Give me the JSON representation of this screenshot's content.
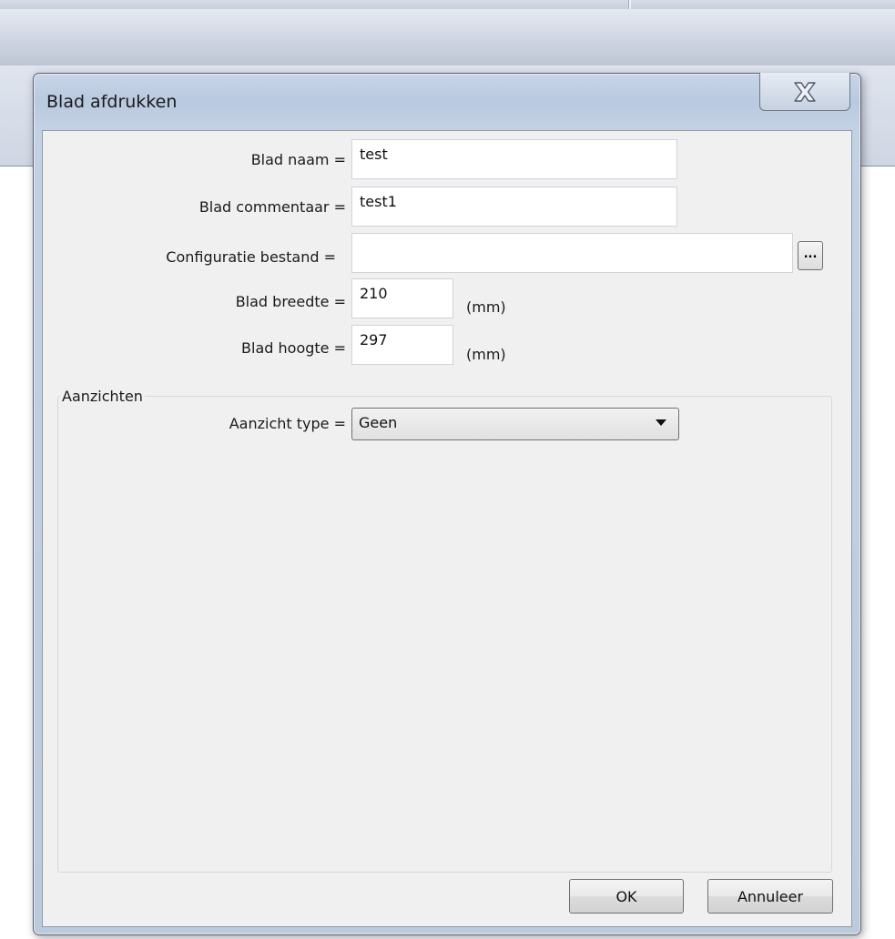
{
  "dialog": {
    "title": "Blad afdrukken",
    "close_icon": "close-icon"
  },
  "form": {
    "sheet_name": {
      "label": "Blad naam =",
      "value": "test"
    },
    "sheet_comment": {
      "label": "Blad commentaar =",
      "value": "test1"
    },
    "config_file": {
      "label": "Configuratie bestand =",
      "value": "",
      "browse_label": "..."
    },
    "sheet_width": {
      "label": "Blad breedte =",
      "value": "210",
      "unit": "(mm)"
    },
    "sheet_height": {
      "label": "Blad hoogte =",
      "value": "297",
      "unit": "(mm)"
    }
  },
  "views": {
    "group_title": "Aanzichten",
    "view_type": {
      "label": "Aanzicht type =",
      "selected": "Geen"
    }
  },
  "buttons": {
    "ok": "OK",
    "cancel": "Annuleer"
  }
}
